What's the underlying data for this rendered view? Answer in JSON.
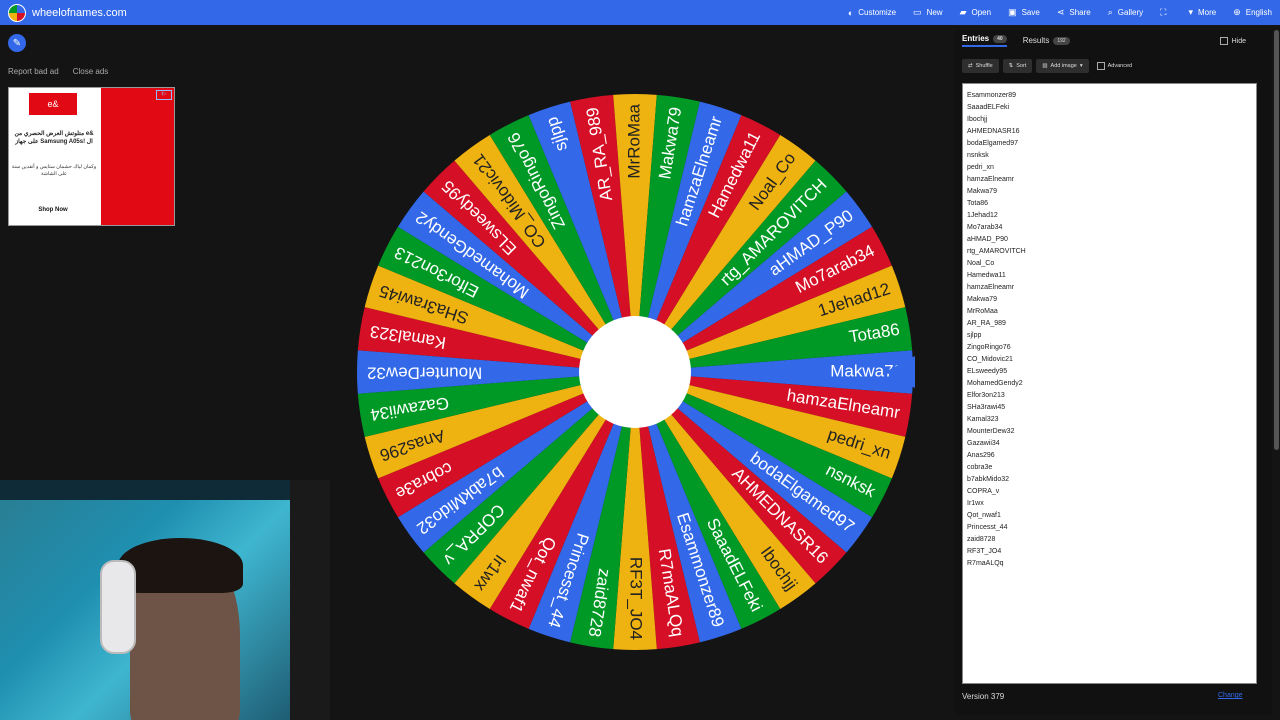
{
  "header": {
    "site": "wheelofnames.com",
    "menu": [
      {
        "icon": "palette-icon",
        "glyph": "◐",
        "label": "Customize"
      },
      {
        "icon": "new-file-icon",
        "glyph": "▭",
        "label": "New"
      },
      {
        "icon": "folder-icon",
        "glyph": "▰",
        "label": "Open"
      },
      {
        "icon": "save-icon",
        "glyph": "▣",
        "label": "Save"
      },
      {
        "icon": "share-icon",
        "glyph": "⋖",
        "label": "Share"
      },
      {
        "icon": "search-icon",
        "glyph": "⌕",
        "label": "Gallery"
      },
      {
        "icon": "fullscreen-icon",
        "glyph": "⛶",
        "label": ""
      },
      {
        "icon": "chevron-down-icon",
        "glyph": "▾",
        "label": "More"
      },
      {
        "icon": "globe-icon",
        "glyph": "⊕",
        "label": "English"
      }
    ]
  },
  "ads": {
    "report": "Report bad ad",
    "close": "Close ads",
    "logo": "e&",
    "text1": "متلوتش العرض الحصري من e& على جهاز Samsung A05s! ال",
    "text2": "وكمان لياك حشمان ستايس و أتقدين سنة على الشاشة",
    "cta": "Shop Now",
    "info": "i▷"
  },
  "wheel": {
    "colors": [
      "#3369e8",
      "#d50f25",
      "#eeb211",
      "#009925"
    ],
    "pointer_color": "#3369e8",
    "segments": [
      "Makwa79",
      "hamzaElneamr",
      "pedri_xn",
      "nsnksk",
      "bodaElgamed97",
      "AHMEDNASR16",
      "Ibochjj",
      "SaaadELFeki",
      "Esammonzer89",
      "R7maALQq",
      "RF3T_JO4",
      "zaid8728",
      "Princesst_44",
      "Qot_nwaf1",
      "Ir1wx",
      "COPRA_v",
      "b7abkMido32",
      "cobra3e",
      "Anas296",
      "Gazawii34",
      "MounterDew32",
      "Kamal323",
      "SHa3rawi45",
      "Elfor3on213",
      "MohamedGendy2",
      "ELsweedy95",
      "CO_Midovic21",
      "ZingoRingo76",
      "sjlpp",
      "AR_RA_989",
      "MrRoMaa",
      "Makwa79",
      "hamzaElneamr",
      "Hamedwa11",
      "Noal_Co",
      "rtg_AMAROVITCH",
      "aHMAD_P90",
      "Mo7arab34",
      "1Jehad12",
      "Tota86"
    ]
  },
  "panel": {
    "tab_entries": "Entries",
    "entries_count": "40",
    "tab_results": "Results",
    "results_count": "192",
    "hide": "Hide",
    "shuffle": "Shuffle",
    "sort": "Sort",
    "add_image": "Add image",
    "advanced": "Advanced",
    "version": "Version 379",
    "changelog": "Change"
  },
  "entries": [
    "Esammonzer89",
    "SaaadELFeki",
    "Ibochjj",
    "AHMEDNASR16",
    "bodaElgamed97",
    "nsnksk",
    "pedri_xn",
    "hamzaElneamr",
    "Makwa79",
    "Tota86",
    "1Jehad12",
    "Mo7arab34",
    "aHMAD_P90",
    "rtg_AMAROVITCH",
    "Noal_Co",
    "Hamedwa11",
    "hamzaElneamr",
    "Makwa79",
    "MrRoMaa",
    "AR_RA_989",
    "sjlpp",
    "ZingoRingo76",
    "CO_Midovic21",
    "ELsweedy95",
    "MohamedGendy2",
    "Elfor3on213",
    "SHa3rawi45",
    "Kamal323",
    "MounterDew32",
    "Gazawii34",
    "Anas296",
    "cobra3e",
    "b7abkMido32",
    "COPRA_v",
    "Ir1wx",
    "Qot_nwaf1",
    "Princesst_44",
    "zaid8728",
    "RF3T_JO4",
    "R7maALQq"
  ]
}
